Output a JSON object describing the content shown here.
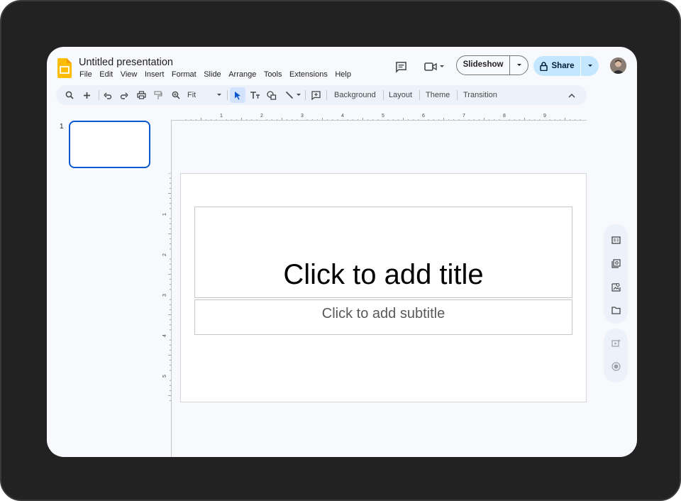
{
  "app": {
    "title": "Untitled presentation",
    "menu": [
      "File",
      "Edit",
      "View",
      "Insert",
      "Format",
      "Slide",
      "Arrange",
      "Tools",
      "Extensions",
      "Help"
    ]
  },
  "header": {
    "slideshow_label": "Slideshow",
    "share_label": "Share"
  },
  "toolbar": {
    "zoom_label": "Fit",
    "background_label": "Background",
    "layout_label": "Layout",
    "theme_label": "Theme",
    "transition_label": "Transition"
  },
  "ruler": {
    "horizontal": [
      "1",
      "2",
      "3",
      "4",
      "5",
      "6",
      "7",
      "8",
      "9"
    ],
    "vertical": [
      "1",
      "2",
      "3",
      "4",
      "5"
    ]
  },
  "filmstrip": {
    "slides": [
      {
        "number": "1"
      }
    ]
  },
  "slide": {
    "title_placeholder": "Click to add title",
    "subtitle_placeholder": "Click to add subtitle"
  },
  "colors": {
    "accent": "#0b57d0",
    "share_bg": "#c2e7ff",
    "toolbar_bg": "#edf2fa",
    "logo": "#fbbc04"
  },
  "icons": {
    "header": [
      "slides-logo-icon",
      "comment-icon",
      "meet-video-icon",
      "lock-icon",
      "avatar"
    ],
    "toolbar": [
      "search-icon",
      "new-slide-plus-icon",
      "undo-icon",
      "redo-icon",
      "print-icon",
      "paint-format-icon",
      "zoom-icon",
      "select-cursor-icon",
      "text-box-icon",
      "shape-icon",
      "line-icon",
      "comment-add-icon",
      "collapse-chevron-icon"
    ],
    "side_panel": [
      "keep-notes-icon",
      "tasks-icon",
      "contacts-icon",
      "drive-folder-icon",
      "video-add-icon",
      "record-icon"
    ]
  }
}
